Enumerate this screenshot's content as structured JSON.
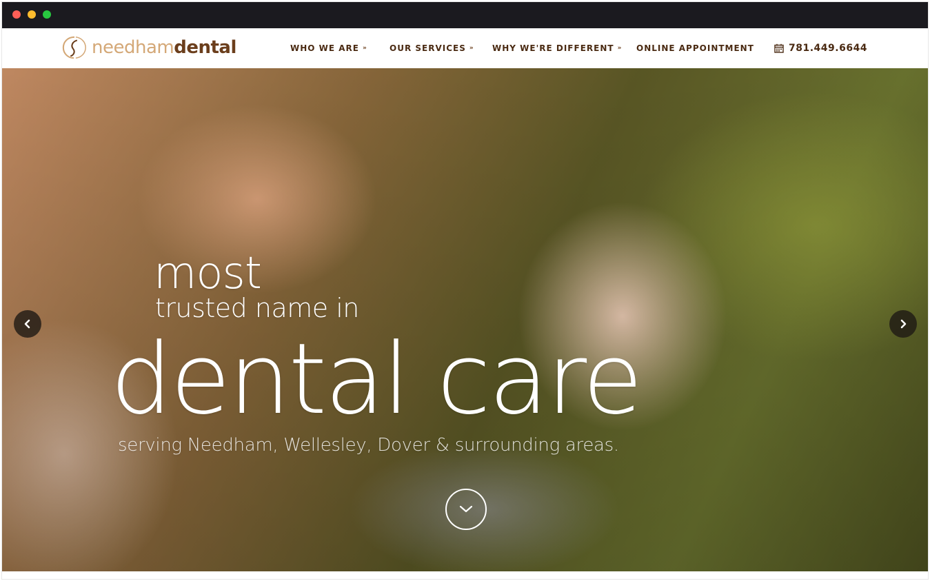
{
  "logo": {
    "light": "needham",
    "dark": "dental"
  },
  "nav": {
    "who_we_are": "WHO WE ARE",
    "our_services": "OUR SERVICES",
    "why_different": "WHY WE'RE DIFFERENT",
    "online_appointment": "ONLINE APPOINTMENT",
    "phone": "781.449.6644"
  },
  "hero": {
    "line1": "most",
    "line2": "trusted name in",
    "line3": "dental care",
    "line4": "serving Needham, Wellesley, Dover & surrounding areas."
  },
  "icons": {
    "dropdown": "chevron-double-down-icon",
    "phone": "calendar-icon",
    "prev": "chevron-left-icon",
    "next": "chevron-right-icon",
    "scroll": "chevron-down-icon"
  },
  "colors": {
    "brand_dark": "#6b3e1c",
    "brand_light": "#d4a877",
    "nav_text": "#4a2a12",
    "chrome": "#1b1a1f"
  }
}
